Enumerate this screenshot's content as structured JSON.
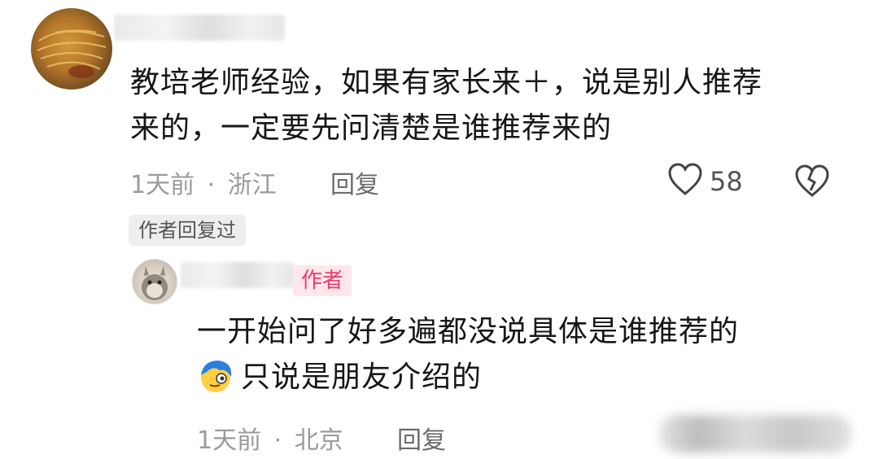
{
  "comment": {
    "text_line1": "教培老师经验，如果有家长来＋，说是别人推荐",
    "text_line2": "来的，一定要先问清楚是谁推荐来的",
    "time": "1天前",
    "separator": "·",
    "location": "浙江",
    "reply_label": "回复",
    "like_count": "58",
    "icons": {
      "like": "heart-outline-icon",
      "dislike": "broken-heart-icon"
    }
  },
  "author_replied_chip": "作者回复过",
  "reply": {
    "author_badge": "作者",
    "text_line1": "一开始问了好多遍都没说具体是谁推荐的",
    "text_line2": "只说是朋友介绍的",
    "emoji_icon": "blue-hair-face-emoji-icon",
    "time": "1天前",
    "separator": "·",
    "location": "北京",
    "reply_label": "回复"
  },
  "colors": {
    "author_badge_bg": "#fde6ec",
    "author_badge_text": "#ef3b6a",
    "meta_gray": "#9b9b9b"
  }
}
